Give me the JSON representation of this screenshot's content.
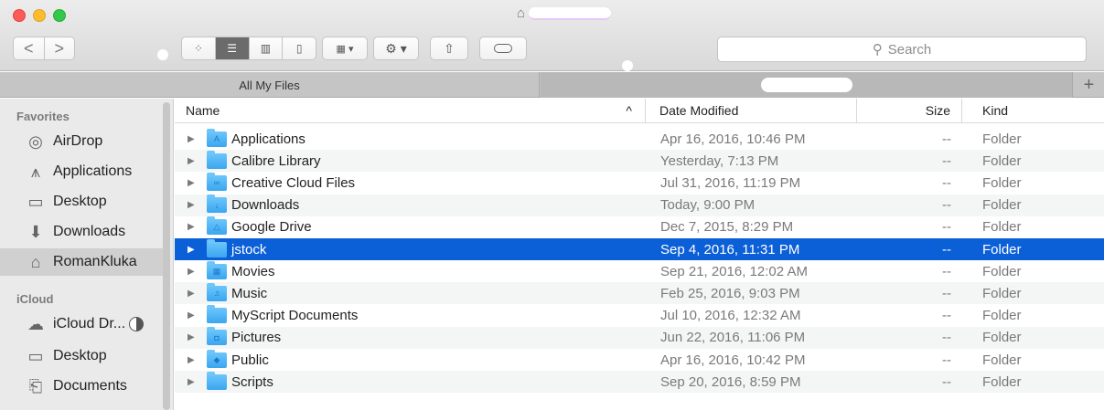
{
  "window": {
    "search_placeholder": "Search"
  },
  "toolbar": {
    "back_glyph": "<",
    "forward_glyph": ">",
    "view_modes": [
      "icon",
      "list",
      "column",
      "cover-flow"
    ],
    "arrange_glyph": "▦ ▾",
    "action_glyph": "⚙ ▾"
  },
  "tabs": [
    {
      "label": "All My Files"
    },
    {
      "label": ""
    }
  ],
  "sidebar": {
    "favorites_header": "Favorites",
    "favorites": [
      {
        "label": "AirDrop",
        "icon": "airdrop-icon"
      },
      {
        "label": "Applications",
        "icon": "applications-icon"
      },
      {
        "label": "Desktop",
        "icon": "desktop-icon"
      },
      {
        "label": "Downloads",
        "icon": "downloads-icon"
      },
      {
        "label": "RomanKluka",
        "icon": "home-icon"
      }
    ],
    "icloud_header": "iCloud",
    "icloud": [
      {
        "label": "iCloud Dr...",
        "icon": "cloud-icon"
      },
      {
        "label": "Desktop",
        "icon": "desktop-icon"
      },
      {
        "label": "Documents",
        "icon": "documents-icon"
      }
    ]
  },
  "columns": {
    "name": "Name",
    "date": "Date Modified",
    "size": "Size",
    "kind": "Kind",
    "sort_glyph": "^"
  },
  "files": [
    {
      "name": "Applications",
      "date": "Apr 16, 2016, 10:46 PM",
      "size": "--",
      "kind": "Folder",
      "badge": "A"
    },
    {
      "name": "Calibre Library",
      "date": "Yesterday, 7:13 PM",
      "size": "--",
      "kind": "Folder",
      "badge": ""
    },
    {
      "name": "Creative Cloud Files",
      "date": "Jul 31, 2016, 11:19 PM",
      "size": "--",
      "kind": "Folder",
      "badge": "∞"
    },
    {
      "name": "Downloads",
      "date": "Today, 9:00 PM",
      "size": "--",
      "kind": "Folder",
      "badge": "↓"
    },
    {
      "name": "Google Drive",
      "date": "Dec 7, 2015, 8:29 PM",
      "size": "--",
      "kind": "Folder",
      "badge": "△"
    },
    {
      "name": "jstock",
      "date": "Sep 4, 2016, 11:31 PM",
      "size": "--",
      "kind": "Folder",
      "badge": ""
    },
    {
      "name": "Movies",
      "date": "Sep 21, 2016, 12:02 AM",
      "size": "--",
      "kind": "Folder",
      "badge": "▦"
    },
    {
      "name": "Music",
      "date": "Feb 25, 2016, 9:03 PM",
      "size": "--",
      "kind": "Folder",
      "badge": "♫"
    },
    {
      "name": "MyScript Documents",
      "date": "Jul 10, 2016, 12:32 AM",
      "size": "--",
      "kind": "Folder",
      "badge": ""
    },
    {
      "name": "Pictures",
      "date": "Jun 22, 2016, 11:06 PM",
      "size": "--",
      "kind": "Folder",
      "badge": "◘"
    },
    {
      "name": "Public",
      "date": "Apr 16, 2016, 10:42 PM",
      "size": "--",
      "kind": "Folder",
      "badge": "◆"
    },
    {
      "name": "Scripts",
      "date": "Sep 20, 2016, 8:59 PM",
      "size": "--",
      "kind": "Folder",
      "badge": ""
    }
  ],
  "selected_file": "jstock"
}
